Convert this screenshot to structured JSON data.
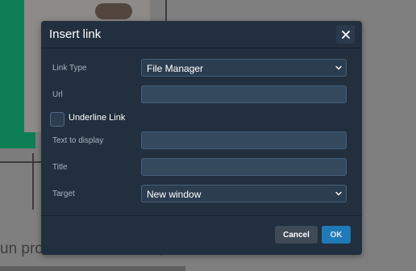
{
  "background": {
    "paragraph_text": "un prodotto in evidenza, una"
  },
  "dialog": {
    "title": "Insert link",
    "close_icon": "close-icon",
    "fields": {
      "link_type": {
        "label": "Link Type",
        "value": "File Manager"
      },
      "url": {
        "label": "Url",
        "value": ""
      },
      "underline": {
        "label": "Underline Link",
        "checked": false
      },
      "text_to_display": {
        "label": "Text to display",
        "value": ""
      },
      "title": {
        "label": "Title",
        "value": ""
      },
      "target": {
        "label": "Target",
        "value": "New window"
      }
    },
    "buttons": {
      "cancel": "Cancel",
      "ok": "OK"
    }
  },
  "colors": {
    "dialog_bg": "#222f3e",
    "accent": "#207ab7"
  }
}
